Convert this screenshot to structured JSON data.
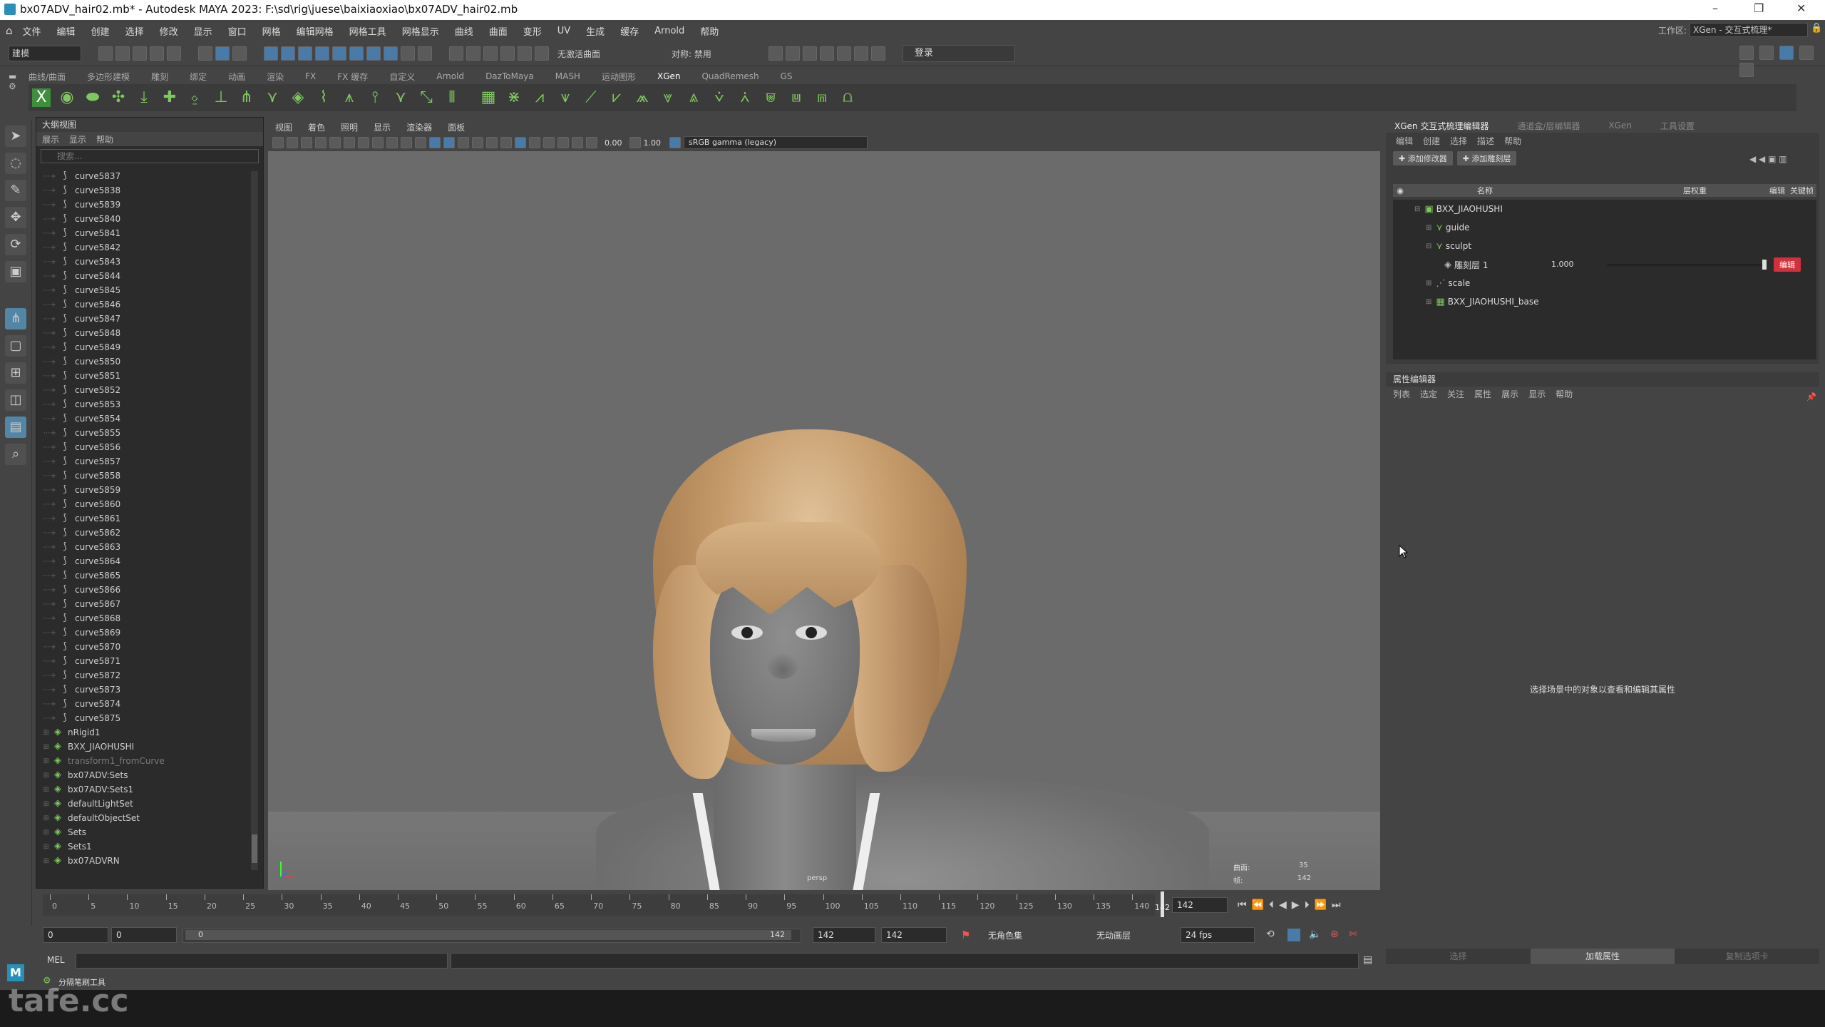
{
  "title": "bx07ADV_hair02.mb* - Autodesk MAYA 2023: F:\\sd\\rig\\juese\\baixiaoxiao\\bx07ADV_hair02.mb",
  "window_controls": {
    "minimize": "–",
    "maximize": "❐",
    "close": "✕"
  },
  "menubar": [
    "文件",
    "编辑",
    "创建",
    "选择",
    "修改",
    "显示",
    "窗口",
    "网格",
    "编辑网格",
    "网格工具",
    "网格显示",
    "曲线",
    "曲面",
    "变形",
    "UV",
    "生成",
    "缓存",
    "Arnold",
    "帮助"
  ],
  "workspace": {
    "label": "工作区:",
    "value": "XGen - 交互式梳理*"
  },
  "status": {
    "mode": "建模",
    "no_live": "无激活曲面",
    "symmetry": "对称: 禁用",
    "login": "登录"
  },
  "shelf_tabs": [
    "曲线/曲面",
    "多边形建模",
    "雕刻",
    "绑定",
    "动画",
    "渲染",
    "FX",
    "FX 缓存",
    "自定义",
    "Arnold",
    "DazToMaya",
    "MASH",
    "运动图形",
    "XGen",
    "QuadRemesh",
    "GS"
  ],
  "shelf_active": "XGen",
  "outliner": {
    "title": "大纲视图",
    "menu": [
      "展示",
      "显示",
      "帮助"
    ],
    "search_placeholder": "搜索...",
    "curves": [
      "curve5837",
      "curve5838",
      "curve5839",
      "curve5840",
      "curve5841",
      "curve5842",
      "curve5843",
      "curve5844",
      "curve5845",
      "curve5846",
      "curve5847",
      "curve5848",
      "curve5849",
      "curve5850",
      "curve5851",
      "curve5852",
      "curve5853",
      "curve5854",
      "curve5855",
      "curve5856",
      "curve5857",
      "curve5858",
      "curve5859",
      "curve5860",
      "curve5861",
      "curve5862",
      "curve5863",
      "curve5864",
      "curve5865",
      "curve5866",
      "curve5867",
      "curve5868",
      "curve5869",
      "curve5870",
      "curve5871",
      "curve5872",
      "curve5873",
      "curve5874",
      "curve5875"
    ],
    "nodes": [
      {
        "label": "nRigid1",
        "dim": false
      },
      {
        "label": "BXX_JIAOHUSHI",
        "dim": false
      },
      {
        "label": "transform1_fromCurve",
        "dim": true
      },
      {
        "label": "bx07ADV:Sets",
        "dim": false
      },
      {
        "label": "bx07ADV:Sets1",
        "dim": false
      },
      {
        "label": "defaultLightSet",
        "dim": false
      },
      {
        "label": "defaultObjectSet",
        "dim": false
      },
      {
        "label": "Sets",
        "dim": false
      },
      {
        "label": "Sets1",
        "dim": false
      },
      {
        "label": "bx07ADVRN",
        "dim": false
      }
    ]
  },
  "viewport": {
    "menu": [
      "视图",
      "着色",
      "照明",
      "显示",
      "渲染器",
      "面板"
    ],
    "exposure": "0.00",
    "gamma": "1.00",
    "colorspace": "sRGB gamma (legacy)",
    "camera": "persp",
    "hud": {
      "label1": "曲面:",
      "value1": "35",
      "label2": "帧:",
      "value2": "142"
    }
  },
  "xgen": {
    "tabs": [
      "XGen 交互式梳理编辑器",
      "通道盒/层编辑器",
      "XGen",
      "工具设置"
    ],
    "menu": [
      "编辑",
      "创建",
      "选择",
      "描述",
      "帮助"
    ],
    "add_modifier": "添加修改器",
    "add_layer": "添加雕刻层",
    "col_name": "名称",
    "col_weight": "层权重",
    "col_edit": "编辑",
    "col_key": "关键帧",
    "tree": [
      {
        "label": "BXX_JIAOHUSHI",
        "indent": 0
      },
      {
        "label": "guide",
        "indent": 1
      },
      {
        "label": "sculpt",
        "indent": 1
      },
      {
        "label": "雕刻层 1",
        "indent": 2,
        "weight": "1.000",
        "edit": "编辑"
      },
      {
        "label": "scale",
        "indent": 1
      },
      {
        "label": "BXX_JIAOHUSHI_base",
        "indent": 1
      }
    ]
  },
  "attribute_editor": {
    "title": "属性编辑器",
    "menu": [
      "列表",
      "选定",
      "关注",
      "属性",
      "展示",
      "显示",
      "帮助"
    ],
    "message": "选择场景中的对象以查看和编辑其属性",
    "footer": [
      "选择",
      "加载属性",
      "复制选项卡"
    ],
    "footer_active": "加载属性"
  },
  "timeline": {
    "ticks": [
      "0",
      "5",
      "10",
      "15",
      "20",
      "25",
      "30",
      "35",
      "40",
      "45",
      "50",
      "55",
      "60",
      "65",
      "70",
      "75",
      "80",
      "85",
      "90",
      "95",
      "100",
      "105",
      "110",
      "115",
      "120",
      "125",
      "130",
      "135",
      "140"
    ],
    "current": "142",
    "current_field": "142"
  },
  "range": {
    "start": "0",
    "start2": "0",
    "slider_start": "0",
    "slider_end": "142",
    "end": "142",
    "end2": "142",
    "character_set": "无角色集",
    "anim_layer": "无动画层",
    "fps": "24 fps"
  },
  "cmdline": {
    "lang": "MEL"
  },
  "helpline": {
    "text": "分隔笔刷工具"
  },
  "watermark": "tafe.cc"
}
